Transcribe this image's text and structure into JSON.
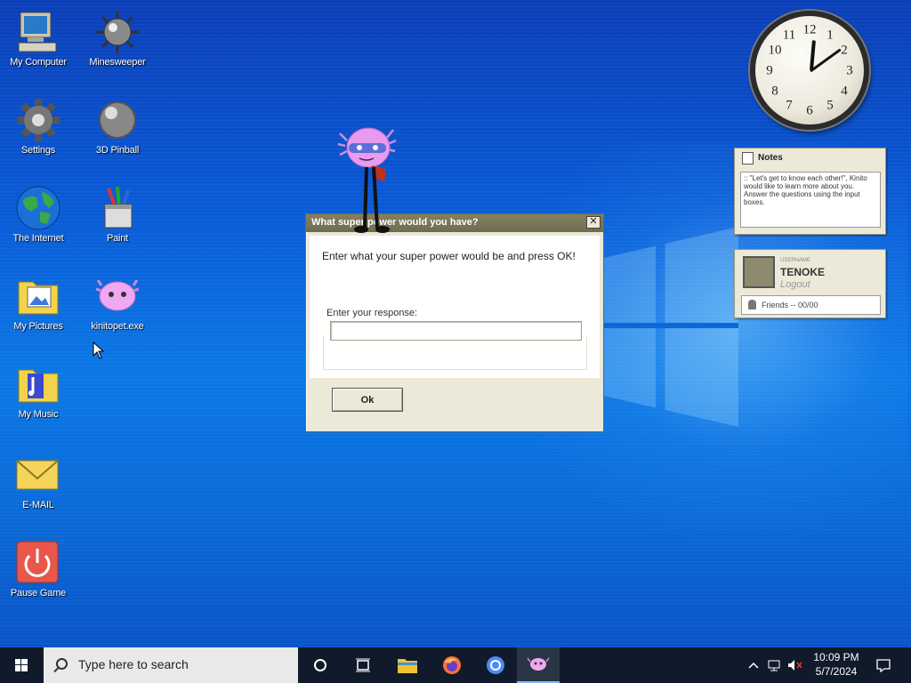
{
  "desktop": {
    "icons": [
      {
        "label": "My Computer",
        "icon": "computer-icon"
      },
      {
        "label": "Minesweeper",
        "icon": "mine-icon"
      },
      {
        "label": "Settings",
        "icon": "gear-icon"
      },
      {
        "label": "3D Pinball",
        "icon": "pinball-icon"
      },
      {
        "label": "The Internet",
        "icon": "globe-icon"
      },
      {
        "label": "Paint",
        "icon": "paint-icon"
      },
      {
        "label": "My Pictures",
        "icon": "pictures-folder-icon"
      },
      {
        "label": "kinitopet.exe",
        "icon": "kinito-icon"
      },
      {
        "label": "My Music",
        "icon": "music-folder-icon"
      },
      {
        "label": "E-MAIL",
        "icon": "envelope-icon"
      },
      {
        "label": "Pause Game",
        "icon": "power-icon"
      }
    ]
  },
  "clock_widget": {
    "numbers": [
      "12",
      "1",
      "2",
      "3",
      "4",
      "5",
      "6",
      "7",
      "8",
      "9",
      "10",
      "11"
    ],
    "time": "10:09"
  },
  "notes_widget": {
    "title": "Notes",
    "text": ":: \"Let's get to know each other!\", Kinito would like to learn more about you. Answer the questions using the input boxes."
  },
  "profile_widget": {
    "caption": "USERNAME",
    "username": "TENOKE",
    "logout": "Logout",
    "friends": "Friends -- 00/00"
  },
  "dialog": {
    "title": "What super power would you have?",
    "close": "✕",
    "prompt": "Enter what your super power would be and press OK!",
    "response_label": "Enter your response:",
    "response_value": "",
    "ok_label": "Ok"
  },
  "taskbar": {
    "search_placeholder": "Type here to search",
    "time": "10:09 PM",
    "date": "5/7/2024"
  },
  "colors": {
    "desktop": "#0a5ad6",
    "taskbar": "#101a2a",
    "dialog_title": "#7a7658",
    "dialog_face": "#ece9d8"
  }
}
